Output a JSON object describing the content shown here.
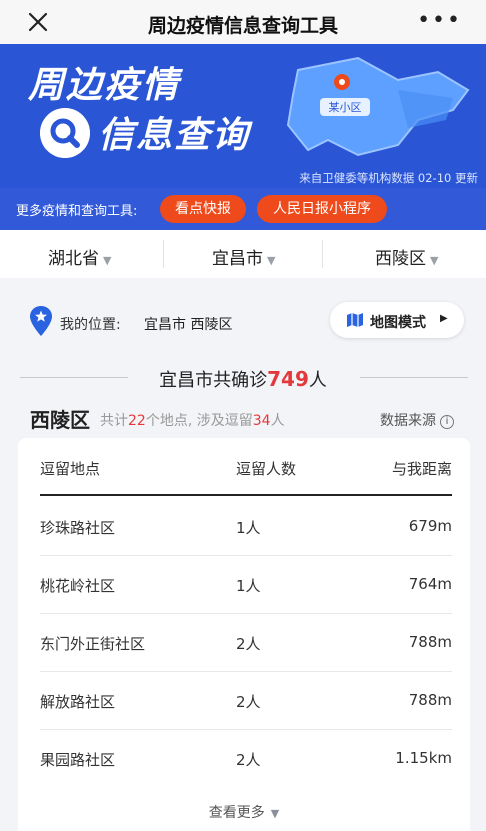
{
  "header": {
    "title": "周边疫情信息查询工具",
    "close_icon": "close-icon",
    "more_icon": "more-dots-icon"
  },
  "banner": {
    "line1": "周边疫情",
    "line2": "信息查询",
    "map_label": "某小区",
    "source": "来自卫健委等机构数据 02-10 更新",
    "colors": {
      "background": "#2a56d6",
      "map": "#5ea0ff"
    }
  },
  "promo": {
    "label": "更多疫情和查询工具:",
    "btn1": "看点快报",
    "btn2": "人民日报小程序",
    "accent": "#ee4a1b"
  },
  "region": {
    "province": "湖北省",
    "city": "宜昌市",
    "district": "西陵区"
  },
  "location": {
    "label": "我的位置:",
    "value": "宜昌市 西陵区",
    "map_mode": "地图模式"
  },
  "summary": {
    "prefix": "宜昌市共确诊",
    "count": "749",
    "suffix": "人"
  },
  "district": {
    "name": "西陵区",
    "sub_prefix": "共计",
    "places": "22",
    "sub_mid": "个地点, 涉及逗留",
    "people": "34",
    "sub_suffix": "人",
    "data_source": "数据来源"
  },
  "table": {
    "columns": [
      "逗留地点",
      "逗留人数",
      "与我距离"
    ],
    "rows": [
      [
        "珍珠路社区",
        "1人",
        "679m"
      ],
      [
        "桃花岭社区",
        "1人",
        "764m"
      ],
      [
        "东门外正街社区",
        "2人",
        "788m"
      ],
      [
        "解放路社区",
        "2人",
        "788m"
      ],
      [
        "果园路社区",
        "2人",
        "1.15km"
      ]
    ],
    "see_more": "查看更多"
  }
}
